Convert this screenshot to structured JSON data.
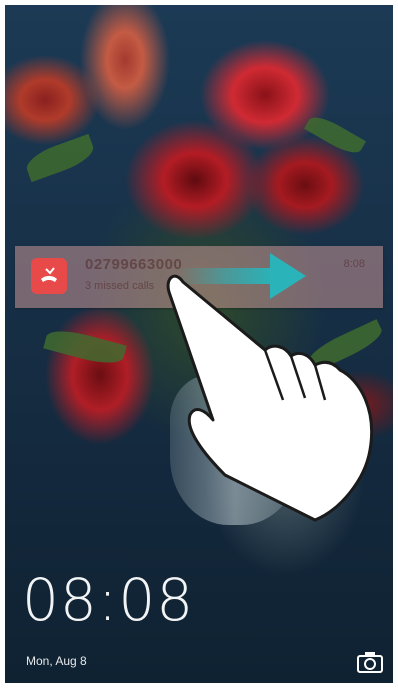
{
  "notification": {
    "number": "02799663000",
    "subtitle": "3 missed calls",
    "time": "8:08",
    "icon": "missed-call-icon",
    "accent": "#e84a4a"
  },
  "gesture": {
    "direction": "swipe-right",
    "arrow_color": "#2ab3b8"
  },
  "lockscreen": {
    "time": "08:08",
    "date": "Mon, Aug 8",
    "camera_icon": "camera-icon"
  }
}
